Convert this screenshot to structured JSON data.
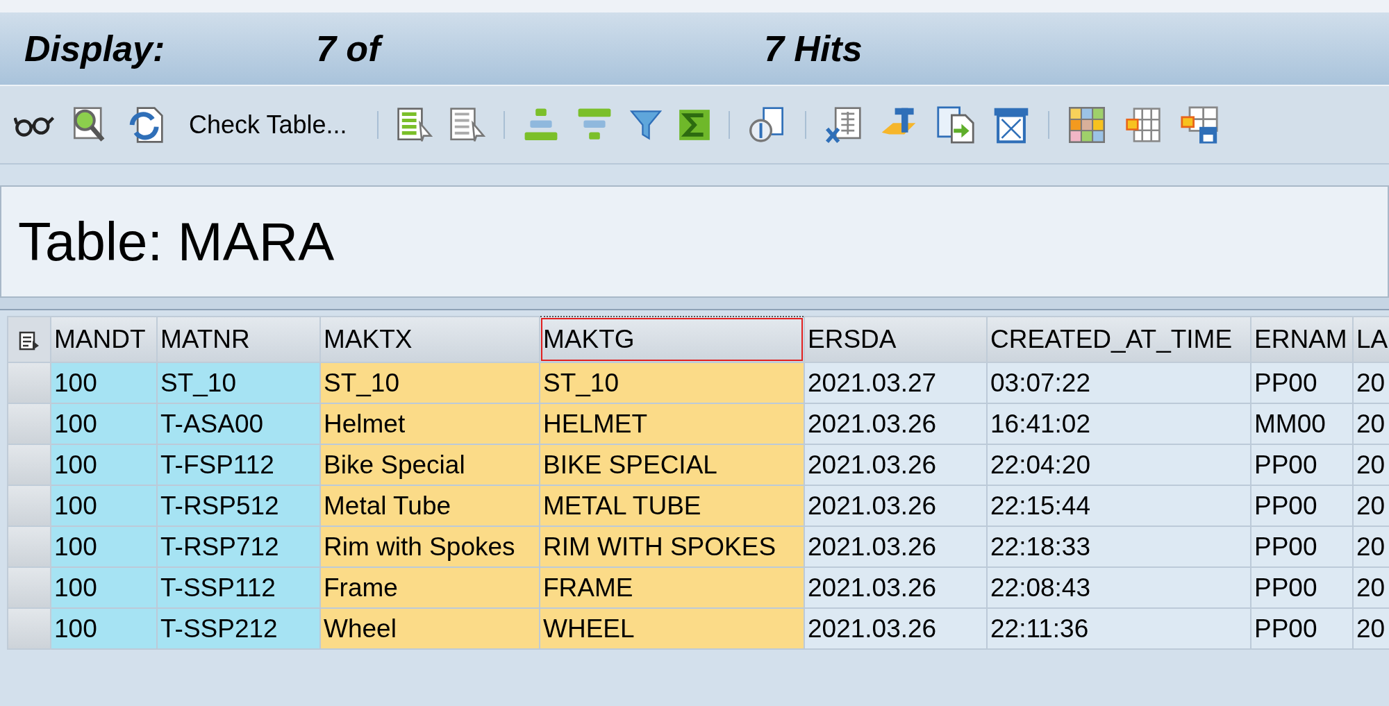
{
  "title_bar": {
    "label": "Display:",
    "count": "7 of",
    "hits": "7 Hits"
  },
  "toolbar": {
    "check_table_button": "Check Table..."
  },
  "header": {
    "title": "Table: MARA"
  },
  "table": {
    "columns": [
      {
        "label": "MANDT",
        "kind": "key",
        "selected": false
      },
      {
        "label": "MATNR",
        "kind": "key",
        "selected": false
      },
      {
        "label": "MAKTX",
        "kind": "text",
        "selected": false
      },
      {
        "label": "MAKTG",
        "kind": "text",
        "selected": true
      },
      {
        "label": "ERSDA",
        "kind": "plain",
        "selected": false
      },
      {
        "label": "CREATED_AT_TIME",
        "kind": "plain",
        "selected": false
      },
      {
        "label": "ERNAM",
        "kind": "plain",
        "selected": false
      },
      {
        "label": "LA",
        "kind": "plain",
        "selected": false
      }
    ],
    "rows": [
      [
        "100",
        "ST_10",
        "ST_10",
        "ST_10",
        "2021.03.27",
        "03:07:22",
        "PP00",
        "20"
      ],
      [
        "100",
        "T-ASA00",
        "Helmet",
        "HELMET",
        "2021.03.26",
        "16:41:02",
        "MM00",
        "20"
      ],
      [
        "100",
        "T-FSP112",
        "Bike Special",
        "BIKE SPECIAL",
        "2021.03.26",
        "22:04:20",
        "PP00",
        "20"
      ],
      [
        "100",
        "T-RSP512",
        "Metal Tube",
        "METAL TUBE",
        "2021.03.26",
        "22:15:44",
        "PP00",
        "20"
      ],
      [
        "100",
        "T-RSP712",
        "Rim with Spokes",
        "RIM WITH SPOKES",
        "2021.03.26",
        "22:18:33",
        "PP00",
        "20"
      ],
      [
        "100",
        "T-SSP112",
        "Frame",
        "FRAME",
        "2021.03.26",
        "22:08:43",
        "PP00",
        "20"
      ],
      [
        "100",
        "T-SSP212",
        "Wheel",
        "WHEEL",
        "2021.03.26",
        "22:11:36",
        "PP00",
        "20"
      ]
    ]
  }
}
